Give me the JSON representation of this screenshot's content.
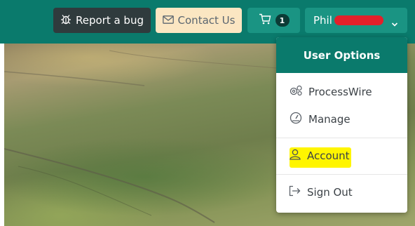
{
  "topbar": {
    "report_bug_label": "Report a bug",
    "contact_label": "Contact Us",
    "cart_count": "1",
    "user_name": "Phil",
    "icons": {
      "report_bug": "bug-icon",
      "contact": "envelope-icon",
      "cart": "cart-icon",
      "user_menu": "chevron-down-icon"
    }
  },
  "user_menu": {
    "header": "User Options",
    "items": [
      {
        "label": "ProcessWire",
        "icon": "gears-icon"
      },
      {
        "label": "Manage",
        "icon": "dashboard-icon"
      },
      {
        "label": "Account",
        "icon": "user-icon",
        "highlighted": true
      },
      {
        "label": "Sign Out",
        "icon": "sign-out-icon"
      }
    ]
  },
  "colors": {
    "brand_teal": "#0a7a6c",
    "button_dark": "#2f3b3d",
    "button_contact": "#fbe6c2",
    "highlight": "#fff500",
    "redaction": "#e3202a"
  }
}
